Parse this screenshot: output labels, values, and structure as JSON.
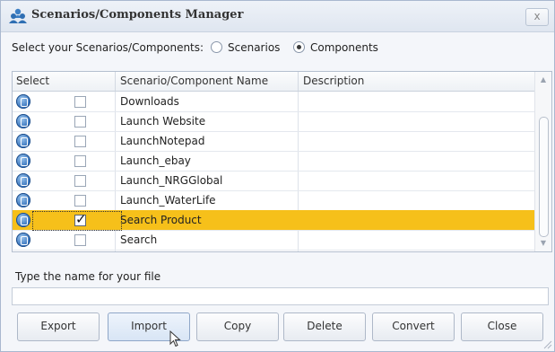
{
  "window": {
    "title": "Scenarios/Components Manager",
    "close_label": "x"
  },
  "selector": {
    "label": "Select your Scenarios/Components:",
    "options": [
      {
        "label": "Scenarios",
        "selected": false
      },
      {
        "label": "Components",
        "selected": true
      }
    ]
  },
  "grid": {
    "columns": [
      "Select",
      "Scenario/Component Name",
      "Description"
    ],
    "rows": [
      {
        "name": "Downloads",
        "checked": false,
        "selected": false
      },
      {
        "name": "Launch Website",
        "checked": false,
        "selected": false
      },
      {
        "name": "LaunchNotepad",
        "checked": false,
        "selected": false
      },
      {
        "name": "Launch_ebay",
        "checked": false,
        "selected": false
      },
      {
        "name": "Launch_NRGGlobal",
        "checked": false,
        "selected": false
      },
      {
        "name": "Launch_WaterLife",
        "checked": false,
        "selected": false
      },
      {
        "name": "Search Product",
        "checked": true,
        "selected": true
      },
      {
        "name": "Search",
        "checked": false,
        "selected": false
      }
    ],
    "selected_color": "#f6c01a"
  },
  "file": {
    "label": "Type the name for your file",
    "value": ""
  },
  "buttons": {
    "export": "Export",
    "import": "Import",
    "copy": "Copy",
    "delete": "Delete",
    "convert": "Convert",
    "close": "Close"
  },
  "icons": {
    "title": "users-group-icon",
    "row": "component-icon"
  }
}
